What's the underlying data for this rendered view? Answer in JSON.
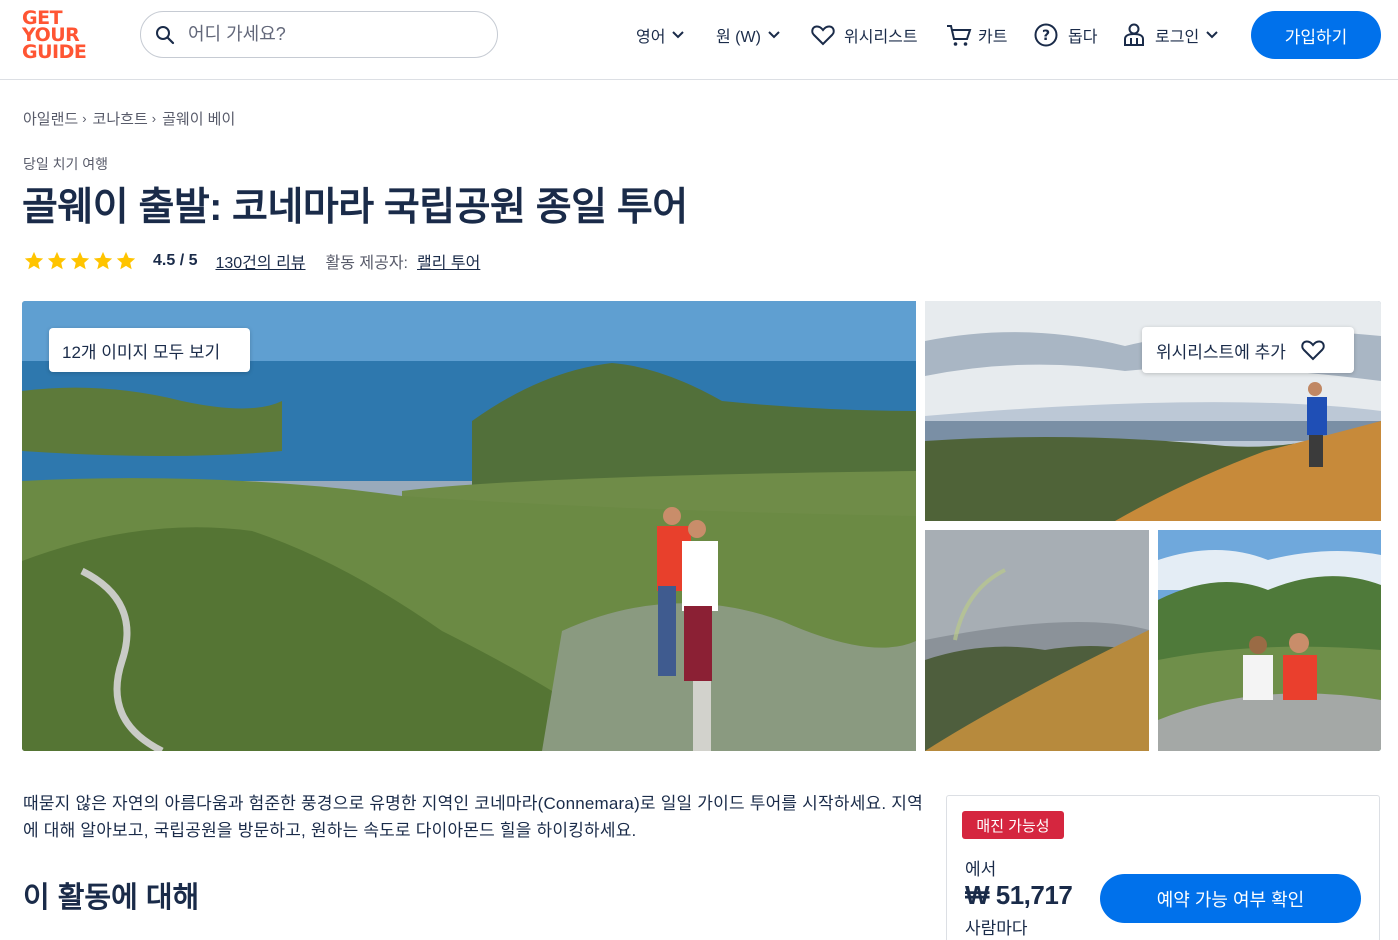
{
  "header": {
    "logo_lines": [
      "GET",
      "YOUR",
      "GUIDE"
    ],
    "search_placeholder": "어디 가세요?",
    "language": "영어",
    "currency": "원 (W)",
    "wishlist": "위시리스트",
    "cart": "카트",
    "help": "돕다",
    "login": "로그인",
    "signup": "가입하기"
  },
  "breadcrumb": [
    "아일랜드",
    "코나흐트",
    "골웨이 베이"
  ],
  "category": "당일 치기 여행",
  "title": "골웨이 출발: 코네마라 국립공원 종일 투어",
  "rating": {
    "stars": 5,
    "value": "4.5 / 5",
    "reviews": "130건의 리뷰",
    "provider_label": "활동 제공자:",
    "provider": "랠리 투어"
  },
  "gallery": {
    "see_all": "12개 이미지 모두 보기",
    "wishlist_add": "위시리스트에 추가"
  },
  "description": "때묻지 않은 자연의 아름다움과 험준한 풍경으로 유명한 지역인 코네마라(Connemara)로 일일 가이드 투어를 시작하세요. 지역에 대해 알아보고, 국립공원을 방문하고, 원하는 속도로 다이아몬드 힐을 하이킹하세요.",
  "about_heading": "이 활동에 대해",
  "booking": {
    "badge": "매진 가능성",
    "from": "에서",
    "price": "₩ 51,717",
    "per_person": "사람마다",
    "check_button": "예약 가능 여부 확인"
  },
  "colors": {
    "brand_orange": "#ff5533",
    "primary_blue": "#0071eb",
    "badge_red": "#d5263f",
    "star_yellow": "#ffc400",
    "text_dark": "#1a2b49"
  }
}
